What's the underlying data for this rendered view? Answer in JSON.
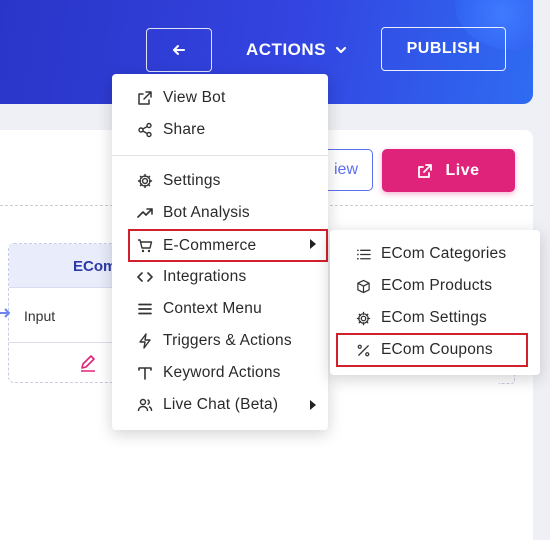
{
  "header": {
    "back_icon": "arrow-left-icon",
    "actions_label": "ACTIONS",
    "publish_label": "PUBLISH",
    "colors": {
      "gradient_start": "#2a35c8",
      "gradient_end": "#2f6bf2"
    }
  },
  "toolbar": {
    "preview_label": "iew",
    "live_label": "Live",
    "live_color": "#e0237a"
  },
  "node": {
    "title": "ECom",
    "input_label": "Input"
  },
  "menu": {
    "items": [
      {
        "label": "View Bot",
        "icon": "external-link-icon"
      },
      {
        "label": "Share",
        "icon": "share-icon"
      },
      {
        "label": "Settings",
        "icon": "gear-icon"
      },
      {
        "label": "Bot Analysis",
        "icon": "trend-up-icon"
      },
      {
        "label": "E-Commerce",
        "icon": "cart-icon",
        "has_submenu": true,
        "highlighted": true
      },
      {
        "label": "Integrations",
        "icon": "code-icon"
      },
      {
        "label": "Context Menu",
        "icon": "hamburger-icon"
      },
      {
        "label": "Triggers & Actions",
        "icon": "lightning-icon"
      },
      {
        "label": "Keyword Actions",
        "icon": "text-t-icon"
      },
      {
        "label": "Live Chat (Beta)",
        "icon": "users-icon",
        "has_submenu": true
      }
    ]
  },
  "submenu": {
    "items": [
      {
        "label": "ECom Categories",
        "icon": "list-icon"
      },
      {
        "label": "ECom Products",
        "icon": "box-icon"
      },
      {
        "label": "ECom Settings",
        "icon": "gear-icon"
      },
      {
        "label": "ECom Coupons",
        "icon": "percent-icon",
        "highlighted": true
      }
    ]
  },
  "highlight_color": "#d0202e"
}
